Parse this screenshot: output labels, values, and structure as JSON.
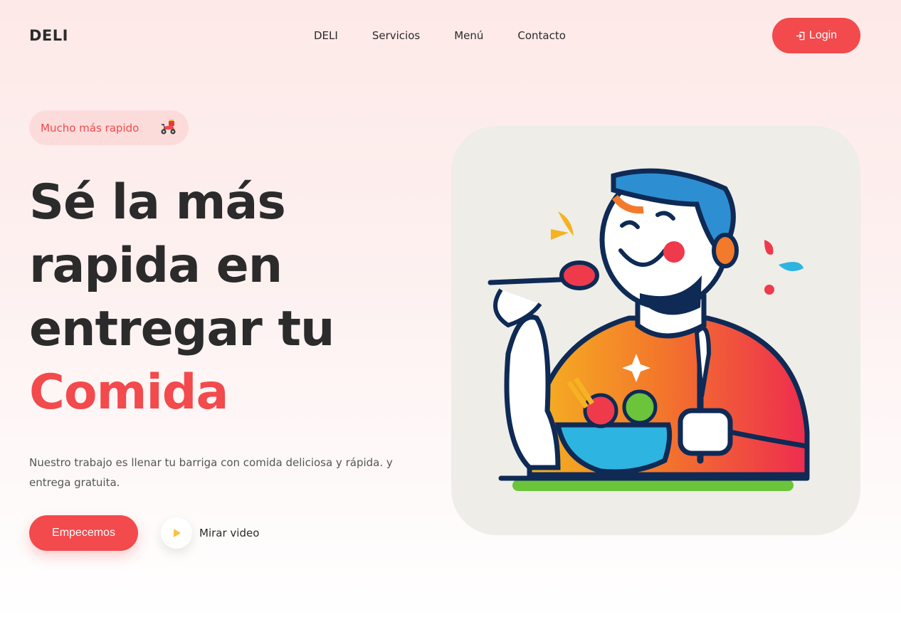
{
  "header": {
    "brand": "DELI",
    "nav": [
      "DELI",
      "Servicios",
      "Menú",
      "Contacto"
    ],
    "login_label": "Login"
  },
  "hero": {
    "badge_text": "Mucho más rapido",
    "headline_lines": [
      "Sé la más",
      "rapida en",
      "entregar tu"
    ],
    "headline_accent": "Comida",
    "description": "Nuestro trabajo es llenar tu barriga con comida deliciosa y rápida. y entrega gratuita.",
    "cta_label": "Empecemos",
    "video_label": "Mirar video"
  },
  "colors": {
    "accent": "#f24a4d",
    "text": "#2b2b2b",
    "badge_bg": "#fcdcdb",
    "card_bg": "#eeede8"
  },
  "icons": {
    "login": "login-arrow-icon",
    "badge": "scooter-icon",
    "video": "play-icon"
  }
}
